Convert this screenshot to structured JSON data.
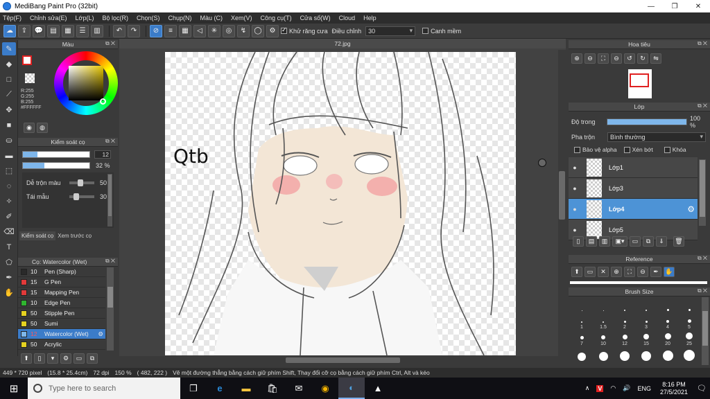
{
  "window": {
    "title": "MediBang Paint Pro (32bit)",
    "minimize": "—",
    "maximize": "❐",
    "close": "✕"
  },
  "menu": [
    "Tệp(F)",
    "Chỉnh sửa(E)",
    "Lớp(L)",
    "Bộ lọc(R)",
    "Chọn(S)",
    "Chụp(N)",
    "Màu (C)",
    "Xem(V)",
    "Công cụ(T)",
    "Cửa số(W)",
    "Cloud",
    "Help"
  ],
  "toolbar": {
    "antialias_label": "Khử răng cưa",
    "adjust_label": "Điều chỉnh",
    "adjust_value": "30",
    "snap_label": "Canh mềm"
  },
  "canvas": {
    "tab_title": "72.jpg",
    "signature_text": "Qtb"
  },
  "color_panel": {
    "title": "Màu",
    "r": "R:255",
    "g": "G:255",
    "b": "B:255",
    "hex": "#FFFFFF"
  },
  "brush_control": {
    "title": "Kiểm soát cọ",
    "size_value": "12",
    "opacity_value": "32 %",
    "blend_label": "Dễ trộn màu",
    "blend_value": "50",
    "resample_label": "Tái mẫu",
    "resample_value": "30",
    "tab1": "Kiểm soát cọ",
    "tab2": "Xem trước cọ"
  },
  "brush_list": {
    "title": "Cọ: Watercolor (Wet)",
    "items": [
      {
        "size": "10",
        "name": "Pen (Sharp)",
        "color": "#2a2a2a"
      },
      {
        "size": "15",
        "name": "G Pen",
        "color": "#e23a3a"
      },
      {
        "size": "15",
        "name": "Mapping Pen",
        "color": "#e23a3a"
      },
      {
        "size": "10",
        "name": "Edge Pen",
        "color": "#2fb52f"
      },
      {
        "size": "50",
        "name": "Stipple Pen",
        "color": "#e6d220"
      },
      {
        "size": "50",
        "name": "Sumi",
        "color": "#e6d220"
      },
      {
        "size": "12",
        "name": "Watercolor (Wet)",
        "color": "#7eb6ea"
      },
      {
        "size": "50",
        "name": "Acrylic",
        "color": "#e6d220"
      }
    ]
  },
  "navigator": {
    "title": "Hoa tiêu"
  },
  "layers": {
    "title": "Lớp",
    "opacity_label": "Độ trong",
    "opacity_value": "100 %",
    "opacity_fraction": 1.0,
    "blend_label": "Pha trộn",
    "blend_value": "Bình thường",
    "protect_alpha": "Bảo vệ alpha",
    "clipping": "Xén bớt",
    "lock": "Khóa",
    "items": [
      {
        "name": "Lớp1",
        "active": false
      },
      {
        "name": "Lớp3",
        "active": false
      },
      {
        "name": "Lớp4",
        "active": true
      },
      {
        "name": "Lớp5",
        "active": false
      }
    ]
  },
  "reference": {
    "title": "Reference"
  },
  "brush_size": {
    "title": "Brush Size",
    "sizes": [
      "",
      "",
      "",
      "",
      "",
      "",
      "1",
      "1.5",
      "2",
      "3",
      "4",
      "5",
      "7",
      "10",
      "12",
      "15",
      "20",
      "25",
      "",
      "",
      "",
      "",
      "",
      ""
    ]
  },
  "status": {
    "dimensions": "449 * 720 pixel",
    "physical": "(15.8 * 25.4cm)",
    "dpi": "72 dpi",
    "zoom": "150 %",
    "coords": "( 482, 222 )",
    "hint": "Vẽ một đường thẳng bằng cách giữ phím Shift, Thay đổi cỡ cọ bằng cách giữ phím Ctrl, Alt và kéo"
  },
  "taskbar": {
    "search_placeholder": "Type here to search",
    "lang": "ENG",
    "time": "8:16 PM",
    "date": "27/5/2021"
  },
  "colors": {
    "accent": "#3b7cc9",
    "panel": "#3a3a3a",
    "header": "#474747"
  }
}
